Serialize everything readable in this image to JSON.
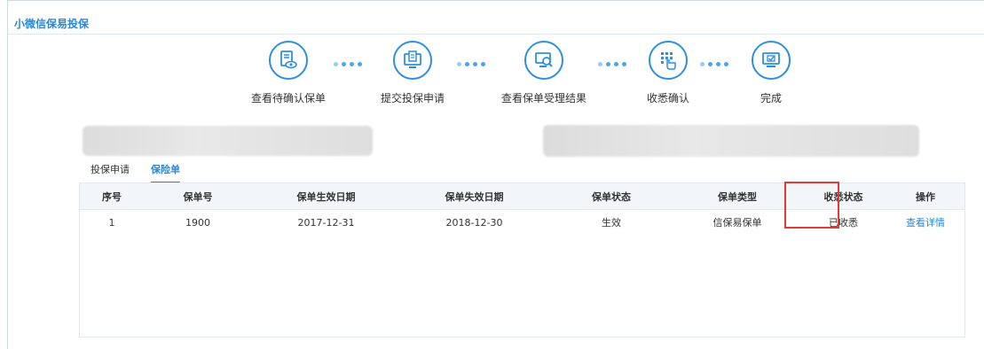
{
  "app": {
    "title": "小微信保易投保"
  },
  "steps": [
    {
      "label": "查看待确认保单",
      "icon": "document-eye-icon"
    },
    {
      "label": "提交投保申请",
      "icon": "monitor-document-icon"
    },
    {
      "label": "查看保单受理结果",
      "icon": "monitor-search-icon"
    },
    {
      "label": "收悉确认",
      "icon": "keypad-hand-icon"
    },
    {
      "label": "完成",
      "icon": "monitor-check-icon"
    }
  ],
  "tabs": [
    {
      "label": "投保申请",
      "active": false
    },
    {
      "label": "保险单",
      "active": true
    }
  ],
  "table": {
    "headers": [
      "序号",
      "保单号",
      "保单生效日期",
      "保单失效日期",
      "保单状态",
      "保单类型",
      "收悉状态",
      "操作"
    ],
    "rows": [
      [
        "1",
        "1900",
        "2017-12-31",
        "2018-12-30",
        "生效",
        "信保易保单",
        "已收悉",
        "查看详情"
      ]
    ]
  },
  "colors": {
    "accent": "#2b87d9",
    "highlight": "#e53935"
  }
}
